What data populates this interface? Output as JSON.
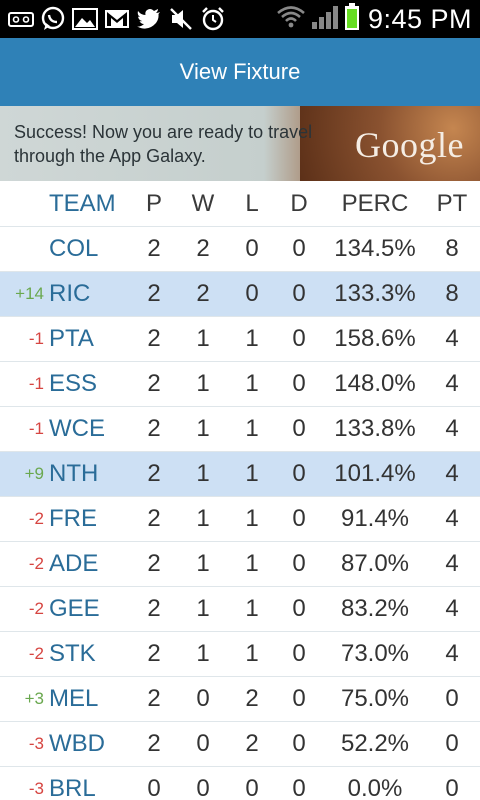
{
  "status_bar": {
    "time": "9:45 PM",
    "icons": [
      "voicemail-icon",
      "whatsapp-icon",
      "gallery-icon",
      "gmail-icon",
      "twitter-icon",
      "mute-icon",
      "alarm-icon",
      "wifi-icon",
      "signal-icon",
      "battery-icon"
    ]
  },
  "title": "View Fixture",
  "ad": {
    "text": "Success! Now you are ready to travel through the App Galaxy.",
    "brand": "Google"
  },
  "table": {
    "headers": {
      "team": "TEAM",
      "p": "P",
      "w": "W",
      "l": "L",
      "d": "D",
      "perc": "PERC",
      "pt": "PT"
    },
    "rows": [
      {
        "change": "",
        "change_dir": "",
        "team": "COL",
        "p": "2",
        "w": "2",
        "l": "0",
        "d": "0",
        "perc": "134.5%",
        "pt": "8",
        "highlight": false
      },
      {
        "change": "+14",
        "change_dir": "up",
        "team": "RIC",
        "p": "2",
        "w": "2",
        "l": "0",
        "d": "0",
        "perc": "133.3%",
        "pt": "8",
        "highlight": true
      },
      {
        "change": "-1",
        "change_dir": "down",
        "team": "PTA",
        "p": "2",
        "w": "1",
        "l": "1",
        "d": "0",
        "perc": "158.6%",
        "pt": "4",
        "highlight": false
      },
      {
        "change": "-1",
        "change_dir": "down",
        "team": "ESS",
        "p": "2",
        "w": "1",
        "l": "1",
        "d": "0",
        "perc": "148.0%",
        "pt": "4",
        "highlight": false
      },
      {
        "change": "-1",
        "change_dir": "down",
        "team": "WCE",
        "p": "2",
        "w": "1",
        "l": "1",
        "d": "0",
        "perc": "133.8%",
        "pt": "4",
        "highlight": false
      },
      {
        "change": "+9",
        "change_dir": "up",
        "team": "NTH",
        "p": "2",
        "w": "1",
        "l": "1",
        "d": "0",
        "perc": "101.4%",
        "pt": "4",
        "highlight": true
      },
      {
        "change": "-2",
        "change_dir": "down",
        "team": "FRE",
        "p": "2",
        "w": "1",
        "l": "1",
        "d": "0",
        "perc": "91.4%",
        "pt": "4",
        "highlight": false
      },
      {
        "change": "-2",
        "change_dir": "down",
        "team": "ADE",
        "p": "2",
        "w": "1",
        "l": "1",
        "d": "0",
        "perc": "87.0%",
        "pt": "4",
        "highlight": false
      },
      {
        "change": "-2",
        "change_dir": "down",
        "team": "GEE",
        "p": "2",
        "w": "1",
        "l": "1",
        "d": "0",
        "perc": "83.2%",
        "pt": "4",
        "highlight": false
      },
      {
        "change": "-2",
        "change_dir": "down",
        "team": "STK",
        "p": "2",
        "w": "1",
        "l": "1",
        "d": "0",
        "perc": "73.0%",
        "pt": "4",
        "highlight": false
      },
      {
        "change": "+3",
        "change_dir": "up",
        "team": "MEL",
        "p": "2",
        "w": "0",
        "l": "2",
        "d": "0",
        "perc": "75.0%",
        "pt": "0",
        "highlight": false
      },
      {
        "change": "-3",
        "change_dir": "down",
        "team": "WBD",
        "p": "2",
        "w": "0",
        "l": "2",
        "d": "0",
        "perc": "52.2%",
        "pt": "0",
        "highlight": false
      },
      {
        "change": "-3",
        "change_dir": "down",
        "team": "BRL",
        "p": "0",
        "w": "0",
        "l": "0",
        "d": "0",
        "perc": "0.0%",
        "pt": "0",
        "highlight": false
      }
    ]
  },
  "colors": {
    "title_bar": "#2f81b7",
    "team_text": "#2a6c98",
    "highlight_row": "#cde0f4",
    "change_up": "#6aa84f",
    "change_down": "#d64541"
  }
}
